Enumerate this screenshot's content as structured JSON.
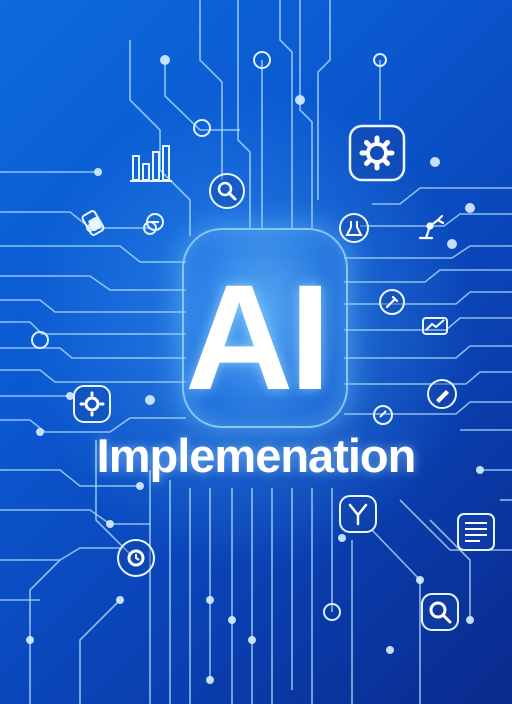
{
  "title": "AI",
  "subtitle": "Implemenation",
  "colors": {
    "background_top": "#0d6bdc",
    "background_bottom": "#0a2a8c",
    "line": "#b9e4ff",
    "text": "#ffffff"
  },
  "icons": [
    "gear-icon",
    "bar-chart-icon",
    "magnifier-icon",
    "robot-arm-icon",
    "flask-icon",
    "document-icon",
    "funnel-icon",
    "cog-icon",
    "clock-icon",
    "pen-icon",
    "tag-icon"
  ]
}
